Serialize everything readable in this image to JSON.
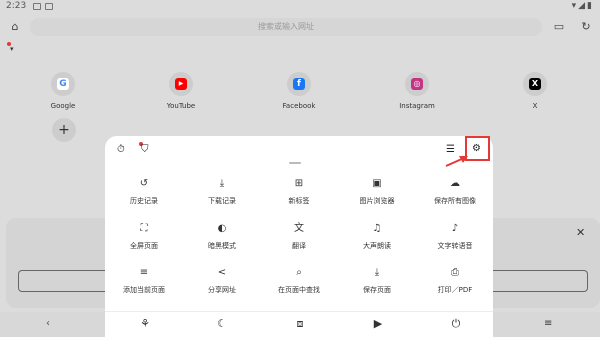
{
  "status": {
    "time": "2:23"
  },
  "toolbar": {
    "url_placeholder": "搜索或输入网址"
  },
  "shortcuts": [
    {
      "label": "Google",
      "icon": "google-icon",
      "color": "#4285F4",
      "glyph": "G"
    },
    {
      "label": "YouTube",
      "icon": "youtube-icon",
      "color": "#FF0000",
      "glyph": "▶"
    },
    {
      "label": "Facebook",
      "icon": "facebook-icon",
      "color": "#1877F2",
      "glyph": "f"
    },
    {
      "label": "Instagram",
      "icon": "instagram-icon",
      "color": "#C13584",
      "glyph": "◎"
    },
    {
      "label": "X",
      "icon": "x-icon",
      "color": "#000000",
      "glyph": "X"
    }
  ],
  "menu": {
    "row1": [
      {
        "label": "历史记录",
        "icon": "history-icon",
        "glyph": "↺"
      },
      {
        "label": "下载记录",
        "icon": "download-icon",
        "glyph": "⤓"
      },
      {
        "label": "新标签",
        "icon": "new-tab-icon",
        "glyph": "⊞"
      },
      {
        "label": "图片浏览器",
        "icon": "image-browser-icon",
        "glyph": "▣"
      },
      {
        "label": "保存所有图像",
        "icon": "save-images-icon",
        "glyph": "☁"
      }
    ],
    "row2": [
      {
        "label": "全屏页面",
        "icon": "fullscreen-icon",
        "glyph": "⛶"
      },
      {
        "label": "暗黑模式",
        "icon": "dark-mode-icon",
        "glyph": "◐"
      },
      {
        "label": "翻译",
        "icon": "translate-icon",
        "glyph": "文"
      },
      {
        "label": "大声朗读",
        "icon": "read-aloud-icon",
        "glyph": "♫"
      },
      {
        "label": "文字转语音",
        "icon": "text-to-speech-icon",
        "glyph": "♪"
      }
    ],
    "row3": [
      {
        "label": "添加当前页面",
        "icon": "add-page-icon",
        "glyph": "≡"
      },
      {
        "label": "分享网址",
        "icon": "share-icon",
        "glyph": "<"
      },
      {
        "label": "在页面中查找",
        "icon": "find-in-page-icon",
        "glyph": "⌕"
      },
      {
        "label": "保存页面",
        "icon": "save-page-icon",
        "glyph": "⤓"
      },
      {
        "label": "打印／PDF",
        "icon": "print-icon",
        "glyph": "⎙"
      }
    ]
  },
  "colors": {
    "accent_red": "#e53935"
  }
}
